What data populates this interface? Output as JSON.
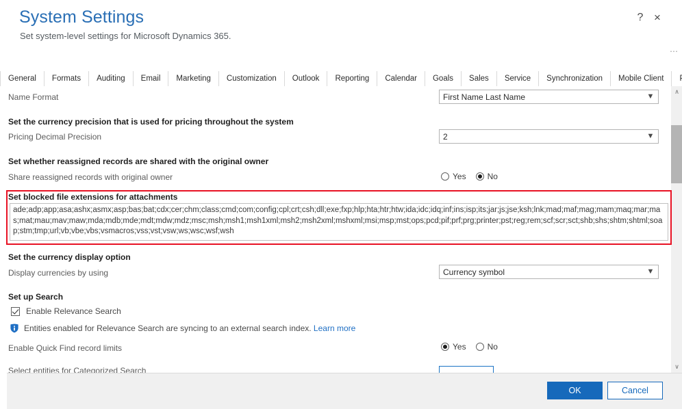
{
  "header": {
    "title": "System Settings",
    "subtitle": "Set system-level settings for Microsoft Dynamics 365.",
    "help_label": "?",
    "close_label": "×",
    "overflow_label": "⋯"
  },
  "tabs": [
    {
      "label": "General",
      "active": true
    },
    {
      "label": "Formats",
      "active": false
    },
    {
      "label": "Auditing",
      "active": false
    },
    {
      "label": "Email",
      "active": false
    },
    {
      "label": "Marketing",
      "active": false
    },
    {
      "label": "Customization",
      "active": false
    },
    {
      "label": "Outlook",
      "active": false
    },
    {
      "label": "Reporting",
      "active": false
    },
    {
      "label": "Calendar",
      "active": false
    },
    {
      "label": "Goals",
      "active": false
    },
    {
      "label": "Sales",
      "active": false
    },
    {
      "label": "Service",
      "active": false
    },
    {
      "label": "Synchronization",
      "active": false
    },
    {
      "label": "Mobile Client",
      "active": false
    },
    {
      "label": "Previews",
      "active": false
    }
  ],
  "form": {
    "name_format_label": "Name Format",
    "name_format_value": "First Name Last Name",
    "currency_precision_heading": "Set the currency precision that is used for pricing throughout the system",
    "pricing_decimal_precision_label": "Pricing Decimal Precision",
    "pricing_decimal_precision_value": "2",
    "reassigned_heading": "Set whether reassigned records are shared with the original owner",
    "share_reassigned_label": "Share reassigned records with original owner",
    "share_reassigned_yes": "Yes",
    "share_reassigned_no": "No",
    "share_reassigned_selected": "No",
    "blocked_ext_heading": "Set blocked file extensions for attachments",
    "blocked_ext_value": "ade;adp;app;asa;ashx;asmx;asp;bas;bat;cdx;cer;chm;class;cmd;com;config;cpl;crt;csh;dll;exe;fxp;hlp;hta;htr;htw;ida;idc;idq;inf;ins;isp;its;jar;js;jse;ksh;lnk;mad;maf;mag;mam;maq;mar;mas;mat;mau;mav;maw;mda;mdb;mde;mdt;mdw;mdz;msc;msh;msh1;msh1xml;msh2;msh2xml;mshxml;msi;msp;mst;ops;pcd;pif;prf;prg;printer;pst;reg;rem;scf;scr;sct;shb;shs;shtm;shtml;soap;stm;tmp;url;vb;vbe;vbs;vsmacros;vss;vst;vsw;ws;wsc;wsf;wsh",
    "currency_display_heading": "Set the currency display option",
    "display_currencies_label": "Display currencies by using",
    "display_currencies_value": "Currency symbol",
    "search_heading": "Set up Search",
    "relevance_search_label": "Enable Relevance Search",
    "relevance_search_checked": "checked",
    "relevance_info_text": "Entities enabled for Relevance Search are syncing to an external search index.",
    "relevance_info_link": "Learn more",
    "quick_find_label": "Enable Quick Find record limits",
    "quick_find_yes": "Yes",
    "quick_find_no": "No",
    "quick_find_selected": "Yes",
    "categorized_search_label": "Select entities for Categorized Search"
  },
  "scrollbar": {
    "up_arrow": "∧",
    "down_arrow": "∨"
  },
  "footer": {
    "ok_label": "OK",
    "cancel_label": "Cancel"
  },
  "colors": {
    "title_blue": "#2a6fb5",
    "accent_blue": "#1669bb",
    "link_blue": "#1f6fc4",
    "highlight_red": "#e81123"
  }
}
